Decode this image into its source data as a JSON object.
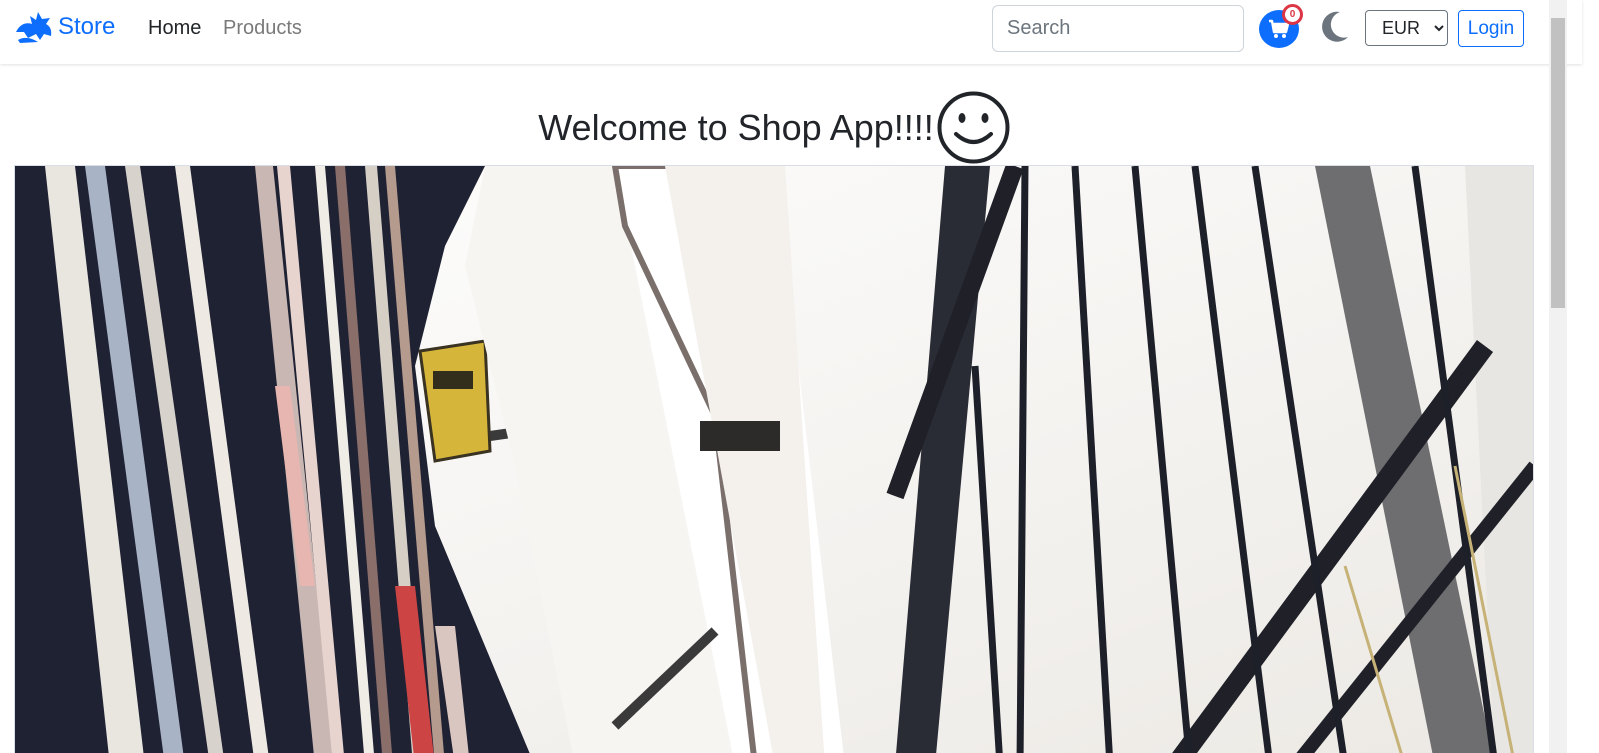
{
  "navbar": {
    "brand_label": "Store",
    "brand_color": "#0d6efd",
    "links": [
      {
        "label": "Home",
        "active": true
      },
      {
        "label": "Products",
        "active": false
      }
    ],
    "search": {
      "placeholder": "Search",
      "value": ""
    },
    "cart": {
      "count": "0",
      "icon": "cart-icon"
    },
    "theme_toggle_icon": "moon-icon",
    "currency": {
      "selected": "EUR"
    },
    "login_label": "Login"
  },
  "main": {
    "heading": "Welcome to Shop App!!!!",
    "heading_icon": "smiley-icon",
    "hero_image": "library-bookshelves-photo"
  }
}
